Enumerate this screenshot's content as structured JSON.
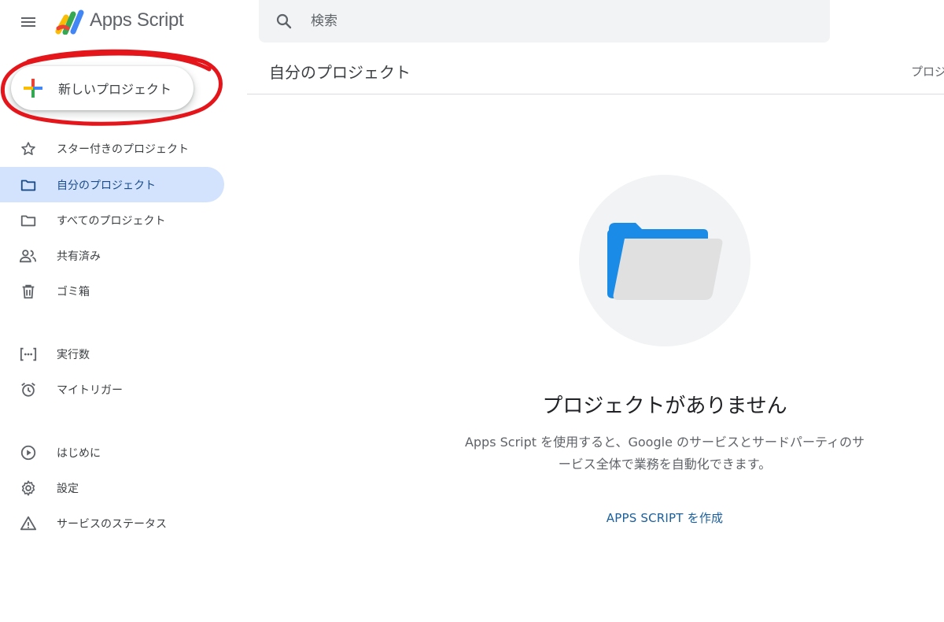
{
  "header": {
    "app_name": "Apps Script",
    "search_placeholder": "検索"
  },
  "sidebar": {
    "new_project_label": "新しいプロジェクト",
    "items": [
      {
        "label": "スター付きのプロジェクト",
        "icon": "star-icon",
        "active": false
      },
      {
        "label": "自分のプロジェクト",
        "icon": "folder-icon",
        "active": true
      },
      {
        "label": "すべてのプロジェクト",
        "icon": "folder-icon",
        "active": false
      },
      {
        "label": "共有済み",
        "icon": "people-icon",
        "active": false
      },
      {
        "label": "ゴミ箱",
        "icon": "trash-icon",
        "active": false
      },
      {
        "label": "実行数",
        "icon": "executions-icon",
        "active": false
      },
      {
        "label": "マイトリガー",
        "icon": "alarm-icon",
        "active": false
      },
      {
        "label": "はじめに",
        "icon": "play-circle-icon",
        "active": false
      },
      {
        "label": "設定",
        "icon": "gear-icon",
        "active": false
      },
      {
        "label": "サービスのステータス",
        "icon": "warning-icon",
        "active": false
      }
    ]
  },
  "main": {
    "title": "自分のプロジェクト",
    "right_header_cut": "プロジ",
    "empty_title": "プロジェクトがありません",
    "empty_desc_line1": "Apps Script を使用すると、Google のサービスとサードパーティのサ",
    "empty_desc_line2": "ービス全体で業務を自動化できます。",
    "create_link": "APPS SCRIPT を作成"
  },
  "colors": {
    "accent": "#1a73e8",
    "active_bg": "#d3e3fd",
    "annotation_red": "#e5161b"
  }
}
